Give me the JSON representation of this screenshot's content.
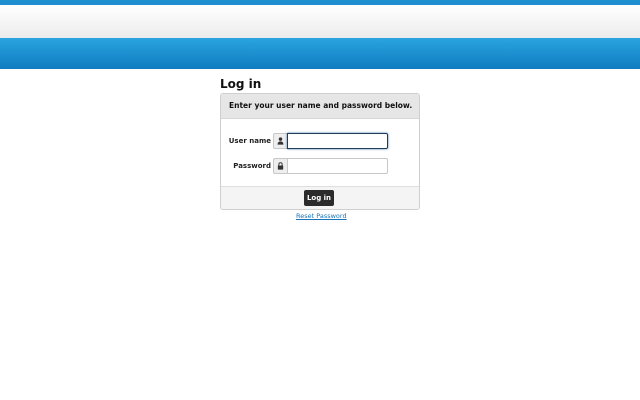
{
  "page": {
    "title": "Log in"
  },
  "login_panel": {
    "instructions": "Enter your user name and password below.",
    "username": {
      "label": "User name",
      "value": "",
      "icon": "user-icon"
    },
    "password": {
      "label": "Password",
      "value": "",
      "icon": "lock-icon"
    },
    "submit_label": "Log in"
  },
  "links": {
    "reset_password": "Reset Password"
  },
  "colors": {
    "header_blue": "#1f8fd0",
    "button_dark": "#2b2b2b",
    "link_blue": "#1a73b5"
  }
}
